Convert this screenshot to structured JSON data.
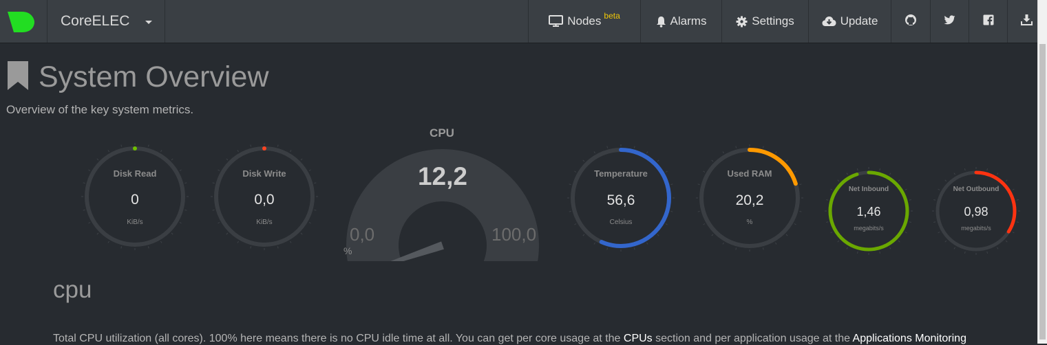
{
  "navbar": {
    "brand": "CoreELEC",
    "items": [
      {
        "label": "Nodes",
        "badge": "beta",
        "icon": "monitor-icon"
      },
      {
        "label": "Alarms",
        "icon": "bell-icon"
      },
      {
        "label": "Settings",
        "icon": "gear-icon"
      },
      {
        "label": "Update",
        "icon": "cloud-download-icon"
      },
      {
        "label": "",
        "icon": "github-icon"
      },
      {
        "label": "",
        "icon": "twitter-icon"
      },
      {
        "label": "",
        "icon": "facebook-icon"
      },
      {
        "label": "",
        "icon": "download-icon"
      }
    ]
  },
  "header": {
    "title": "System Overview",
    "subtitle": "Overview of the key system metrics."
  },
  "gauges": {
    "disk_read": {
      "label": "Disk Read",
      "value": "0",
      "unit": "KiB/s",
      "fraction": 0.0,
      "color": "#6fbf00"
    },
    "disk_write": {
      "label": "Disk Write",
      "value": "0,0",
      "unit": "KiB/s",
      "fraction": 0.0,
      "color": "#ff4422"
    },
    "cpu": {
      "title": "CPU",
      "value": "12,2",
      "min": "0,0",
      "max": "100,0",
      "unit": "%",
      "fraction": 0.122,
      "color": "#22aa99"
    },
    "temperature": {
      "label": "Temperature",
      "value": "56,6",
      "unit": "Celsius",
      "fraction": 0.566,
      "color": "#3366cc"
    },
    "used_ram": {
      "label": "Used RAM",
      "value": "20,2",
      "unit": "%",
      "fraction": 0.202,
      "color": "#ff9900"
    },
    "net_inbound": {
      "label": "Net Inbound",
      "value": "1,46",
      "unit": "megabits/s",
      "fraction": 0.95,
      "color": "#6aa800"
    },
    "net_outbound": {
      "label": "Net Outbound",
      "value": "0,98",
      "unit": "megabits/s",
      "fraction": 0.34,
      "color": "#ff3311"
    }
  },
  "cpu_section": {
    "title": "cpu",
    "text_before": "Total CPU utilization (all cores). 100% here means there is no CPU idle time at all. You can get per core usage at the ",
    "link1": "CPUs",
    "text_middle": " section and per application usage at the ",
    "link2": "Applications Monitoring"
  }
}
